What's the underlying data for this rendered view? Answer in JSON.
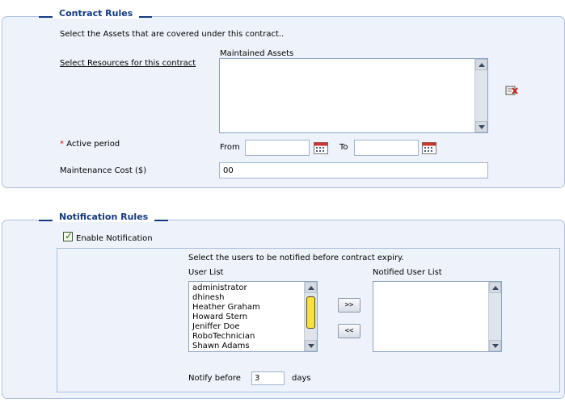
{
  "contract_rules": {
    "legend": "Contract Rules",
    "intro": "Select the Assets that are covered under this contract..",
    "select_resources_link": "Select Resources for this contract",
    "maintained_assets_label": "Maintained Assets",
    "active_period_required": "*",
    "active_period_label": "Active period",
    "from_label": "From",
    "to_label": "To",
    "from_value": "",
    "to_value": "",
    "maintenance_cost_label": "Maintenance Cost ($)",
    "maintenance_cost_value": "00"
  },
  "notification_rules": {
    "legend": "Notification Rules",
    "enable_label": "Enable Notification",
    "enable_checked": true,
    "users_intro": "Select the users to be notified before contract expiry.",
    "user_list_label": "User List",
    "notified_list_label": "Notified User List",
    "users": [
      "administrator",
      "dhinesh",
      "Heather Graham",
      "Howard Stern",
      "Jeniffer Doe",
      "RoboTechnician",
      "Shawn Adams"
    ],
    "add_button": ">>",
    "remove_button": "<<",
    "notify_before_label": "Notify before",
    "notify_before_value": "3",
    "days_label": "days"
  },
  "icons": {
    "calendar": "calendar-icon",
    "remove_asset": "remove-asset-icon"
  },
  "colors": {
    "legend": "#123a80",
    "panel_bg": "#eef3fb",
    "thumb": "#f6e23a"
  }
}
